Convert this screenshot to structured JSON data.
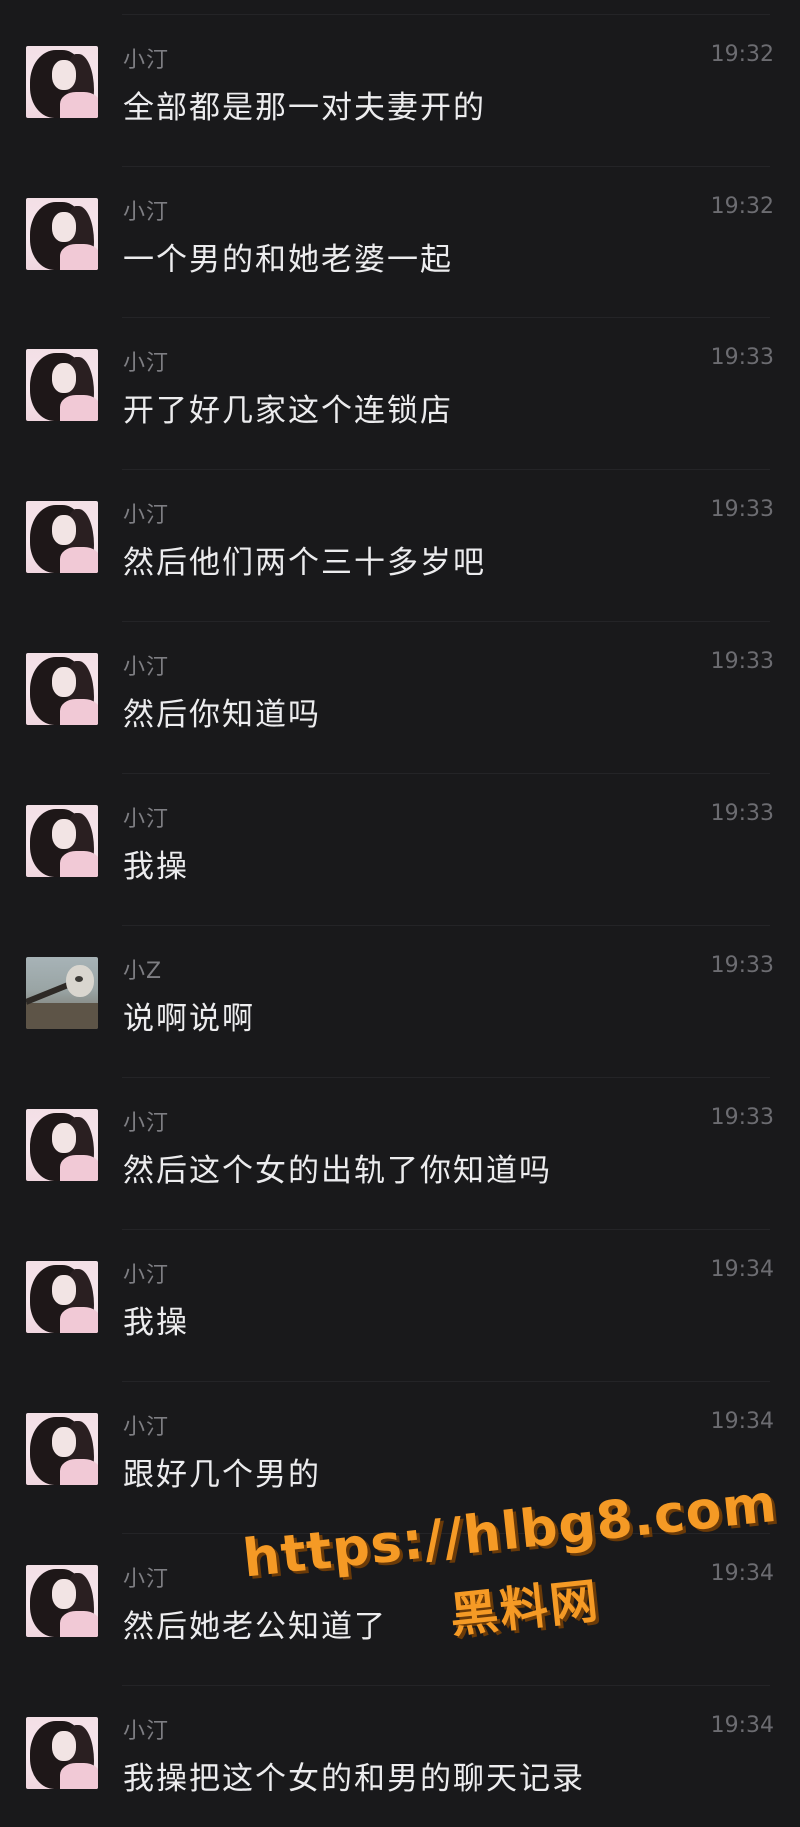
{
  "messages": [
    {
      "sender": "小汀",
      "time": "19:32",
      "text": "全部都是那一对夫妻开的",
      "avatar": "girl-avatar"
    },
    {
      "sender": "小汀",
      "time": "19:32",
      "text": "一个男的和她老婆一起",
      "avatar": "girl-avatar"
    },
    {
      "sender": "小汀",
      "time": "19:33",
      "text": "开了好几家这个连锁店",
      "avatar": "girl-avatar"
    },
    {
      "sender": "小汀",
      "time": "19:33",
      "text": "然后他们两个三十多岁吧",
      "avatar": "girl-avatar"
    },
    {
      "sender": "小汀",
      "time": "19:33",
      "text": "然后你知道吗",
      "avatar": "girl-avatar"
    },
    {
      "sender": "小汀",
      "time": "19:33",
      "text": "我操",
      "avatar": "girl-avatar"
    },
    {
      "sender": "小Z",
      "time": "19:33",
      "text": "说啊说啊",
      "avatar": "plushie-avatar"
    },
    {
      "sender": "小汀",
      "time": "19:33",
      "text": "然后这个女的出轨了你知道吗",
      "avatar": "girl-avatar"
    },
    {
      "sender": "小汀",
      "time": "19:34",
      "text": "我操",
      "avatar": "girl-avatar"
    },
    {
      "sender": "小汀",
      "time": "19:34",
      "text": "跟好几个男的",
      "avatar": "girl-avatar"
    },
    {
      "sender": "小汀",
      "time": "19:34",
      "text": "然后她老公知道了",
      "avatar": "girl-avatar"
    },
    {
      "sender": "小汀",
      "time": "19:34",
      "text": "我操把这个女的和男的聊天记录",
      "avatar": "girl-avatar"
    }
  ],
  "watermark": {
    "url": "https://hlbg8.com",
    "site": "黑料网",
    "color": "#f59a25"
  },
  "colors": {
    "background": "#19191b",
    "name": "#7e7e83",
    "time": "#6c6c71",
    "text": "#ececee"
  }
}
